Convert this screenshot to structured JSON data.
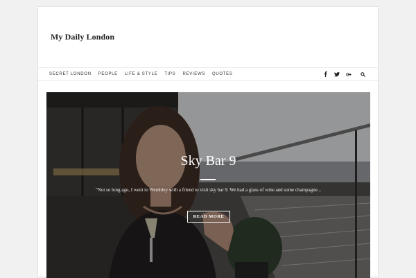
{
  "site": {
    "title": "My Daily London"
  },
  "nav": {
    "items": [
      {
        "label": "SECRET LONDON"
      },
      {
        "label": "PEOPLE"
      },
      {
        "label": "LIFE & STYLE"
      },
      {
        "label": "TIPS"
      },
      {
        "label": "REVIEWS"
      },
      {
        "label": "QUOTES"
      }
    ],
    "icons": [
      "facebook-icon",
      "twitter-icon",
      "google-plus-icon",
      "search-icon"
    ]
  },
  "featured": {
    "title": "Sky Bar 9",
    "excerpt": "\"Not so long ago, I went to Wembley with a friend to visit sky bar 9. We had a glass of wine and some champagne...",
    "button": "READ MORE"
  },
  "colors": {
    "accent": "#ffffff",
    "text": "#222222",
    "border": "#e2e2e2"
  }
}
